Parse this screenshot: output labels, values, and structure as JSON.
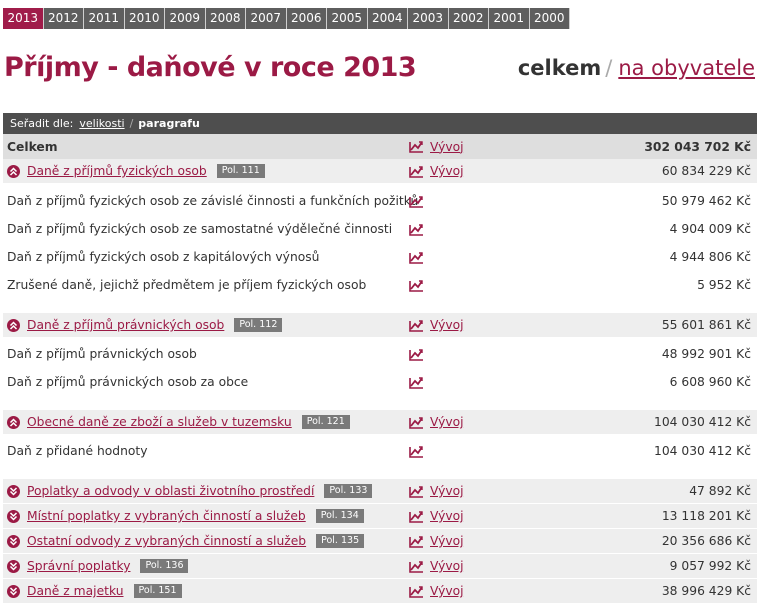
{
  "years": [
    "2013",
    "2012",
    "2011",
    "2010",
    "2009",
    "2008",
    "2007",
    "2006",
    "2005",
    "2004",
    "2003",
    "2002",
    "2001",
    "2000"
  ],
  "active_year": "2013",
  "title": "Příjmy - daňové v roce 2013",
  "mode": {
    "total": "celkem",
    "separator": "/",
    "per_capita": "na obyvatele"
  },
  "sortbar": {
    "label": "Seřadit dle:",
    "by_size": "velikosti",
    "separator": "/",
    "by_paragraph": "paragrafu"
  },
  "trend_label": "Vývoj",
  "colors": {
    "accent": "#9b1a45",
    "active_tab": "#a01c4a",
    "tab": "#5e5e5e",
    "bar": "#4e4e4e"
  },
  "rows": [
    {
      "type": "header",
      "name": "Celkem",
      "trend": true,
      "trend_link": true,
      "value": "302 043 702 Kč"
    },
    {
      "type": "group",
      "name": "Daně z příjmů fyzických osob",
      "pol": "Pol. 111",
      "expanded": true,
      "trend_link": true,
      "value": "60 834 229 Kč"
    },
    {
      "type": "item",
      "name": "Daň z příjmů fyzických osob ze závislé činnosti a funkčních požitků",
      "value": "50 979 462 Kč"
    },
    {
      "type": "item",
      "name": "Daň z příjmů fyzických osob ze samostatné výdělečné činnosti",
      "value": "4 904 009 Kč"
    },
    {
      "type": "item",
      "name": "Daň z příjmů fyzických osob z kapitálových výnosů",
      "value": "4 944 806 Kč"
    },
    {
      "type": "item",
      "name": "Zrušené daně, jejichž předmětem je příjem fyzických osob",
      "value": "5 952 Kč"
    },
    {
      "type": "group",
      "name": "Daně z příjmů právnických osob",
      "pol": "Pol. 112",
      "expanded": true,
      "trend_link": true,
      "value": "55 601 861 Kč"
    },
    {
      "type": "item",
      "name": "Daň z příjmů právnických osob",
      "value": "48 992 901 Kč"
    },
    {
      "type": "item",
      "name": "Daň z příjmů právnických osob za obce",
      "value": "6 608 960 Kč"
    },
    {
      "type": "group",
      "name": "Obecné daně ze zboží a služeb v tuzemsku",
      "pol": "Pol. 121",
      "expanded": true,
      "trend_link": true,
      "value": "104 030 412 Kč"
    },
    {
      "type": "item",
      "name": "Daň z přidané hodnoty",
      "value": "104 030 412 Kč"
    },
    {
      "type": "group",
      "name": "Poplatky a odvody v oblasti životního prostředí",
      "pol": "Pol. 133",
      "expanded": false,
      "trend_link": true,
      "value": "47 892 Kč"
    },
    {
      "type": "group",
      "name": "Místní poplatky z vybraných činností a služeb",
      "pol": "Pol. 134",
      "expanded": false,
      "trend_link": true,
      "value": "13 118 201 Kč"
    },
    {
      "type": "group",
      "name": "Ostatní odvody z vybraných činností a služeb",
      "pol": "Pol. 135",
      "expanded": false,
      "trend_link": true,
      "value": "20 356 686 Kč"
    },
    {
      "type": "group",
      "name": "Správní poplatky",
      "pol": "Pol. 136",
      "expanded": false,
      "trend_link": true,
      "value": "9 057 992 Kč"
    },
    {
      "type": "group",
      "name": "Daně z majetku",
      "pol": "Pol. 151",
      "expanded": false,
      "trend_link": true,
      "value": "38 996 429 Kč"
    }
  ]
}
